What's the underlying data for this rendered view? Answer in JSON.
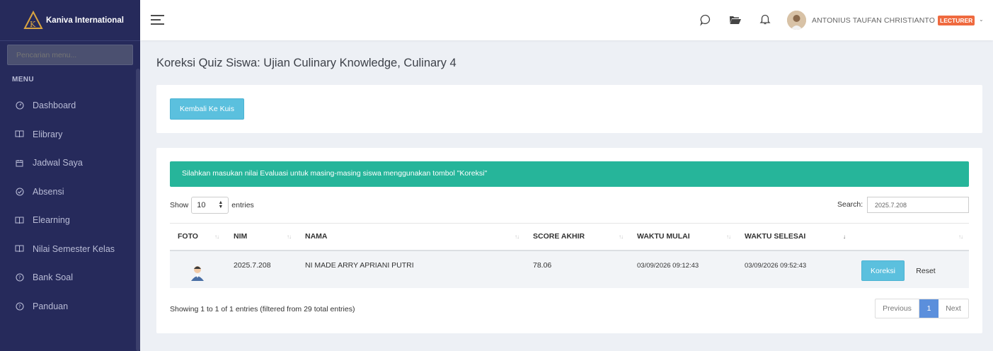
{
  "brand": {
    "name": "Kaniva International"
  },
  "sidebar": {
    "search_placeholder": "Pencarian menu...",
    "menu_heading": "MENU",
    "items": [
      {
        "label": "Dashboard",
        "icon": "gauge-icon"
      },
      {
        "label": "Elibrary",
        "icon": "book-icon"
      },
      {
        "label": "Jadwal Saya",
        "icon": "calendar-icon"
      },
      {
        "label": "Absensi",
        "icon": "check-circle-icon"
      },
      {
        "label": "Elearning",
        "icon": "book-icon"
      },
      {
        "label": "Nilai Semester Kelas",
        "icon": "book-icon"
      },
      {
        "label": "Bank Soal",
        "icon": "help-circle-icon"
      },
      {
        "label": "Panduan",
        "icon": "help-circle-icon"
      }
    ]
  },
  "header": {
    "user_name": "ANTONIUS TAUFAN CHRISTIANTO",
    "role": "LECTURER"
  },
  "page": {
    "title": "Koreksi Quiz Siswa: Ujian Culinary Knowledge, Culinary 4",
    "back_button": "Kembali Ke Kuis",
    "alert": "Silahkan masukan nilai Evaluasi untuk masing-masing siswa menggunakan tombol \"Koreksi\""
  },
  "table_controls": {
    "show_label": "Show",
    "entries_value": "10",
    "entries_label": "entries",
    "search_label": "Search:",
    "search_value": "2025.7.208"
  },
  "table": {
    "columns": [
      "FOTO",
      "NIM",
      "NAMA",
      "SCORE AKHIR",
      "WAKTU MULAI",
      "WAKTU SELESAI",
      ""
    ],
    "rows": [
      {
        "nim": "2025.7.208",
        "nama": "NI MADE ARRY APRIANI PUTRI",
        "score": "78.06",
        "mulai": "03/09/2026 09:12:43",
        "selesai": "03/09/2026 09:52:43",
        "koreksi_label": "Koreksi",
        "reset_label": "Reset"
      }
    ]
  },
  "footer": {
    "info": "Showing 1 to 1 of 1 entries (filtered from 29 total entries)",
    "prev": "Previous",
    "page": "1",
    "next": "Next"
  },
  "colors": {
    "sidebar": "#262a5b",
    "accent_info": "#5bc0de",
    "alert_green": "#26b59a",
    "badge_orange": "#ef6a3f",
    "page_active": "#5b8fdc"
  }
}
